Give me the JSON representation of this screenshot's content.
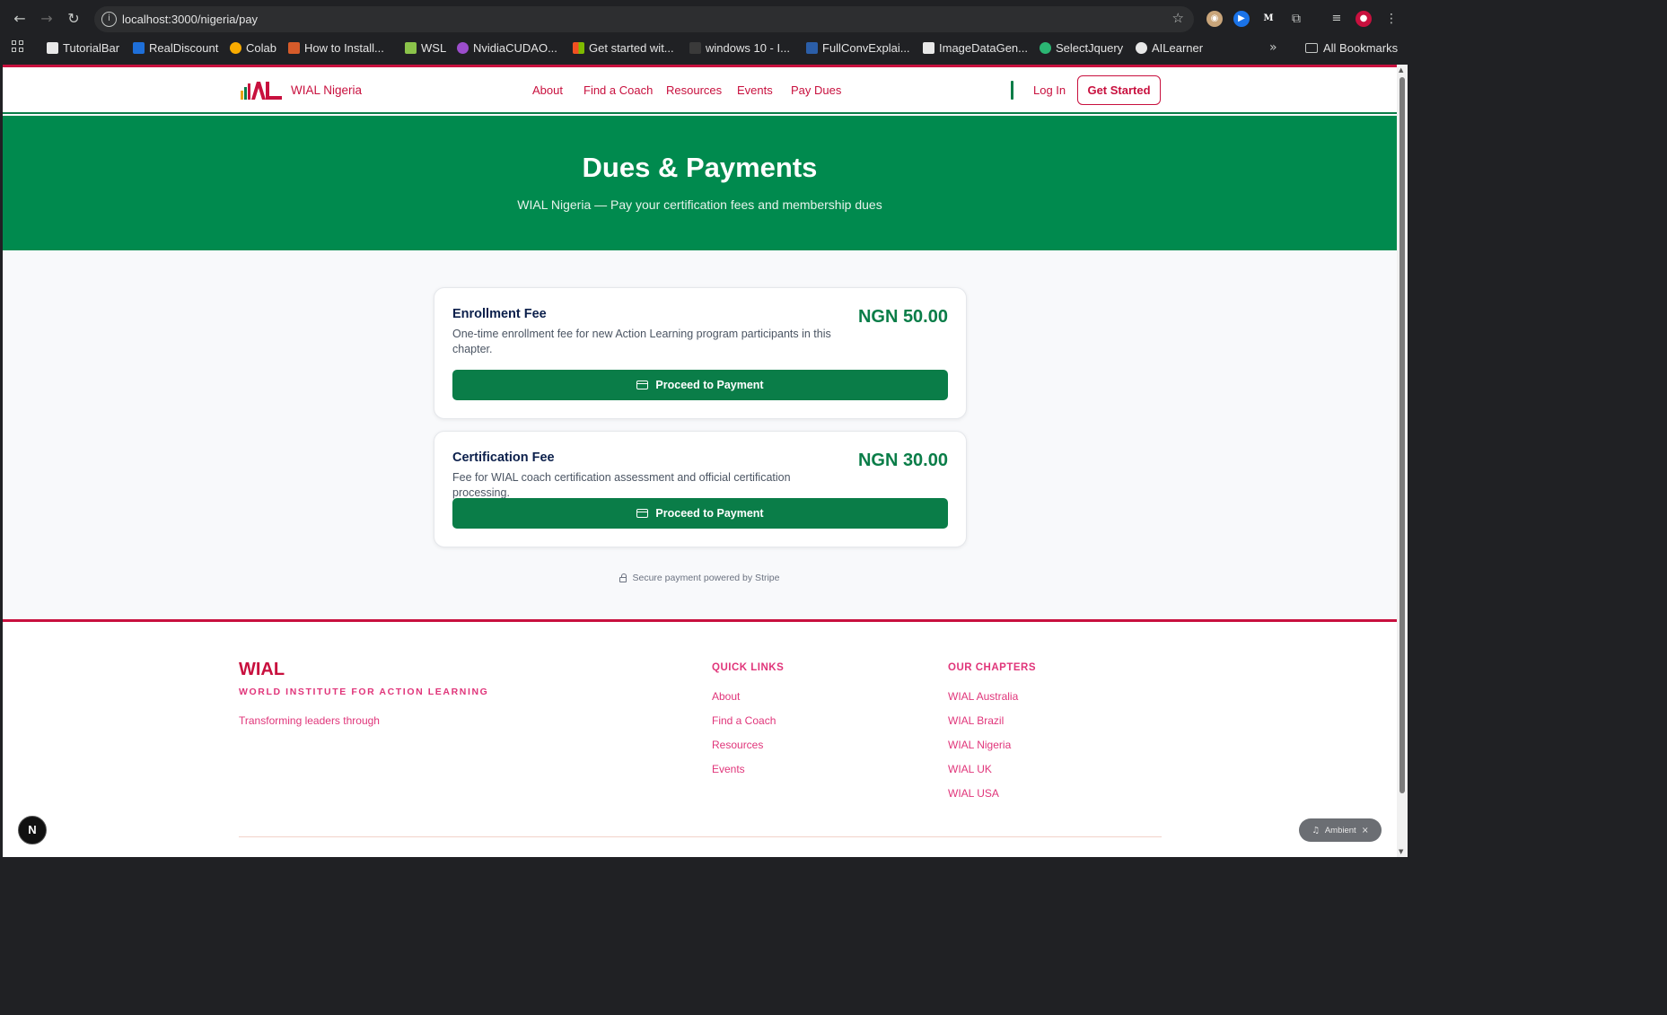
{
  "browser": {
    "url": "localhost:3000/nigeria/pay",
    "bookmarks": [
      {
        "label": "TutorialBar",
        "icon": "tutorialbar-icon",
        "color": "#e8e8e8"
      },
      {
        "label": "RealDiscount",
        "icon": "realdiscount-icon",
        "color": "#1e6fd9"
      },
      {
        "label": "Colab",
        "icon": "colab-icon",
        "color": "#f9ab00"
      },
      {
        "label": "How to Install...",
        "icon": "howto-icon",
        "color": "#d65b2a"
      },
      {
        "label": "WSL",
        "icon": "wsl-icon",
        "color": "#8bc34a"
      },
      {
        "label": "NvidiaCUDAO...",
        "icon": "nvidia-icon",
        "color": "#9c4dcc"
      },
      {
        "label": "Get started wit...",
        "icon": "microsoft-icon",
        "color": "#f25022"
      },
      {
        "label": "windows 10 - I...",
        "icon": "stackoverflow-icon",
        "color": "#3a3a3a"
      },
      {
        "label": "FullConvExplai...",
        "icon": "fullconv-icon",
        "color": "#2b5ea8"
      },
      {
        "label": "ImageDataGen...",
        "icon": "imagedata-icon",
        "color": "#e8e8e8"
      },
      {
        "label": "SelectJquery",
        "icon": "selectjquery-icon",
        "color": "#2bb673"
      },
      {
        "label": "AILearner",
        "icon": "wordpress-icon",
        "color": "#e8e8e8"
      }
    ],
    "all_bookmarks_label": "All Bookmarks"
  },
  "header": {
    "brand": "WIAL Nigeria",
    "nav": [
      "About",
      "Find a Coach",
      "Resources",
      "Events",
      "Pay Dues"
    ],
    "login_label": "Log In",
    "cta_label": "Get Started",
    "colors": {
      "primary": "#c8103e",
      "green": "#0a7d48"
    }
  },
  "hero": {
    "title": "Dues & Payments",
    "subtitle": "WIAL Nigeria — Pay your certification fees and membership dues",
    "background": "#008a4e"
  },
  "fees": [
    {
      "title": "Enrollment Fee",
      "description": "One-time enrollment fee for new Action Learning program participants in this chapter.",
      "price": "NGN 50.00",
      "button_label": "Proceed to Payment"
    },
    {
      "title": "Certification Fee",
      "description": "Fee for WIAL coach certification assessment and official certification processing.",
      "price": "NGN 30.00",
      "button_label": "Proceed to Payment"
    }
  ],
  "secure_note": "Secure payment powered by Stripe",
  "footer": {
    "brand": "WIAL",
    "brand_sub": "WORLD INSTITUTE FOR ACTION LEARNING",
    "tagline": "Transforming leaders through",
    "quick_links_title": "QUICK LINKS",
    "quick_links": [
      "About",
      "Find a Coach",
      "Resources",
      "Events"
    ],
    "chapters_title": "OUR CHAPTERS",
    "chapters": [
      "WIAL Australia",
      "WIAL Brazil",
      "WIAL Nigeria",
      "WIAL UK",
      "WIAL USA"
    ]
  },
  "overlay": {
    "dev_badge": "N",
    "ambient_label": "Ambient"
  }
}
